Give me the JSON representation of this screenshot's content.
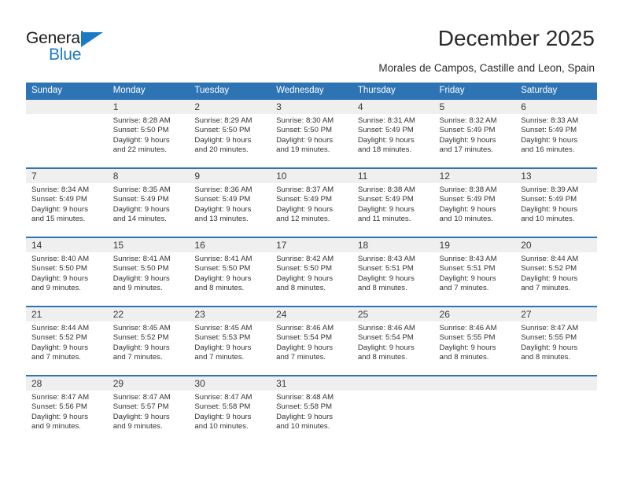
{
  "brand": {
    "name_top": "General",
    "name_bottom": "Blue",
    "accent_color": "#1b7ac4"
  },
  "header": {
    "title": "December 2025",
    "subtitle": "Morales de Campos, Castille and Leon, Spain"
  },
  "theme": {
    "header_bg": "#2e74b5",
    "daynum_bg": "#efefef",
    "text": "#333333"
  },
  "calendar": {
    "weekday_headers": [
      "Sunday",
      "Monday",
      "Tuesday",
      "Wednesday",
      "Thursday",
      "Friday",
      "Saturday"
    ],
    "weeks": [
      [
        {
          "day": "",
          "sunrise": "",
          "sunset": "",
          "daylight_line1": "",
          "daylight_line2": ""
        },
        {
          "day": "1",
          "sunrise": "Sunrise: 8:28 AM",
          "sunset": "Sunset: 5:50 PM",
          "daylight_line1": "Daylight: 9 hours",
          "daylight_line2": "and 22 minutes."
        },
        {
          "day": "2",
          "sunrise": "Sunrise: 8:29 AM",
          "sunset": "Sunset: 5:50 PM",
          "daylight_line1": "Daylight: 9 hours",
          "daylight_line2": "and 20 minutes."
        },
        {
          "day": "3",
          "sunrise": "Sunrise: 8:30 AM",
          "sunset": "Sunset: 5:50 PM",
          "daylight_line1": "Daylight: 9 hours",
          "daylight_line2": "and 19 minutes."
        },
        {
          "day": "4",
          "sunrise": "Sunrise: 8:31 AM",
          "sunset": "Sunset: 5:49 PM",
          "daylight_line1": "Daylight: 9 hours",
          "daylight_line2": "and 18 minutes."
        },
        {
          "day": "5",
          "sunrise": "Sunrise: 8:32 AM",
          "sunset": "Sunset: 5:49 PM",
          "daylight_line1": "Daylight: 9 hours",
          "daylight_line2": "and 17 minutes."
        },
        {
          "day": "6",
          "sunrise": "Sunrise: 8:33 AM",
          "sunset": "Sunset: 5:49 PM",
          "daylight_line1": "Daylight: 9 hours",
          "daylight_line2": "and 16 minutes."
        }
      ],
      [
        {
          "day": "7",
          "sunrise": "Sunrise: 8:34 AM",
          "sunset": "Sunset: 5:49 PM",
          "daylight_line1": "Daylight: 9 hours",
          "daylight_line2": "and 15 minutes."
        },
        {
          "day": "8",
          "sunrise": "Sunrise: 8:35 AM",
          "sunset": "Sunset: 5:49 PM",
          "daylight_line1": "Daylight: 9 hours",
          "daylight_line2": "and 14 minutes."
        },
        {
          "day": "9",
          "sunrise": "Sunrise: 8:36 AM",
          "sunset": "Sunset: 5:49 PM",
          "daylight_line1": "Daylight: 9 hours",
          "daylight_line2": "and 13 minutes."
        },
        {
          "day": "10",
          "sunrise": "Sunrise: 8:37 AM",
          "sunset": "Sunset: 5:49 PM",
          "daylight_line1": "Daylight: 9 hours",
          "daylight_line2": "and 12 minutes."
        },
        {
          "day": "11",
          "sunrise": "Sunrise: 8:38 AM",
          "sunset": "Sunset: 5:49 PM",
          "daylight_line1": "Daylight: 9 hours",
          "daylight_line2": "and 11 minutes."
        },
        {
          "day": "12",
          "sunrise": "Sunrise: 8:38 AM",
          "sunset": "Sunset: 5:49 PM",
          "daylight_line1": "Daylight: 9 hours",
          "daylight_line2": "and 10 minutes."
        },
        {
          "day": "13",
          "sunrise": "Sunrise: 8:39 AM",
          "sunset": "Sunset: 5:49 PM",
          "daylight_line1": "Daylight: 9 hours",
          "daylight_line2": "and 10 minutes."
        }
      ],
      [
        {
          "day": "14",
          "sunrise": "Sunrise: 8:40 AM",
          "sunset": "Sunset: 5:50 PM",
          "daylight_line1": "Daylight: 9 hours",
          "daylight_line2": "and 9 minutes."
        },
        {
          "day": "15",
          "sunrise": "Sunrise: 8:41 AM",
          "sunset": "Sunset: 5:50 PM",
          "daylight_line1": "Daylight: 9 hours",
          "daylight_line2": "and 9 minutes."
        },
        {
          "day": "16",
          "sunrise": "Sunrise: 8:41 AM",
          "sunset": "Sunset: 5:50 PM",
          "daylight_line1": "Daylight: 9 hours",
          "daylight_line2": "and 8 minutes."
        },
        {
          "day": "17",
          "sunrise": "Sunrise: 8:42 AM",
          "sunset": "Sunset: 5:50 PM",
          "daylight_line1": "Daylight: 9 hours",
          "daylight_line2": "and 8 minutes."
        },
        {
          "day": "18",
          "sunrise": "Sunrise: 8:43 AM",
          "sunset": "Sunset: 5:51 PM",
          "daylight_line1": "Daylight: 9 hours",
          "daylight_line2": "and 8 minutes."
        },
        {
          "day": "19",
          "sunrise": "Sunrise: 8:43 AM",
          "sunset": "Sunset: 5:51 PM",
          "daylight_line1": "Daylight: 9 hours",
          "daylight_line2": "and 7 minutes."
        },
        {
          "day": "20",
          "sunrise": "Sunrise: 8:44 AM",
          "sunset": "Sunset: 5:52 PM",
          "daylight_line1": "Daylight: 9 hours",
          "daylight_line2": "and 7 minutes."
        }
      ],
      [
        {
          "day": "21",
          "sunrise": "Sunrise: 8:44 AM",
          "sunset": "Sunset: 5:52 PM",
          "daylight_line1": "Daylight: 9 hours",
          "daylight_line2": "and 7 minutes."
        },
        {
          "day": "22",
          "sunrise": "Sunrise: 8:45 AM",
          "sunset": "Sunset: 5:52 PM",
          "daylight_line1": "Daylight: 9 hours",
          "daylight_line2": "and 7 minutes."
        },
        {
          "day": "23",
          "sunrise": "Sunrise: 8:45 AM",
          "sunset": "Sunset: 5:53 PM",
          "daylight_line1": "Daylight: 9 hours",
          "daylight_line2": "and 7 minutes."
        },
        {
          "day": "24",
          "sunrise": "Sunrise: 8:46 AM",
          "sunset": "Sunset: 5:54 PM",
          "daylight_line1": "Daylight: 9 hours",
          "daylight_line2": "and 7 minutes."
        },
        {
          "day": "25",
          "sunrise": "Sunrise: 8:46 AM",
          "sunset": "Sunset: 5:54 PM",
          "daylight_line1": "Daylight: 9 hours",
          "daylight_line2": "and 8 minutes."
        },
        {
          "day": "26",
          "sunrise": "Sunrise: 8:46 AM",
          "sunset": "Sunset: 5:55 PM",
          "daylight_line1": "Daylight: 9 hours",
          "daylight_line2": "and 8 minutes."
        },
        {
          "day": "27",
          "sunrise": "Sunrise: 8:47 AM",
          "sunset": "Sunset: 5:55 PM",
          "daylight_line1": "Daylight: 9 hours",
          "daylight_line2": "and 8 minutes."
        }
      ],
      [
        {
          "day": "28",
          "sunrise": "Sunrise: 8:47 AM",
          "sunset": "Sunset: 5:56 PM",
          "daylight_line1": "Daylight: 9 hours",
          "daylight_line2": "and 9 minutes."
        },
        {
          "day": "29",
          "sunrise": "Sunrise: 8:47 AM",
          "sunset": "Sunset: 5:57 PM",
          "daylight_line1": "Daylight: 9 hours",
          "daylight_line2": "and 9 minutes."
        },
        {
          "day": "30",
          "sunrise": "Sunrise: 8:47 AM",
          "sunset": "Sunset: 5:58 PM",
          "daylight_line1": "Daylight: 9 hours",
          "daylight_line2": "and 10 minutes."
        },
        {
          "day": "31",
          "sunrise": "Sunrise: 8:48 AM",
          "sunset": "Sunset: 5:58 PM",
          "daylight_line1": "Daylight: 9 hours",
          "daylight_line2": "and 10 minutes."
        },
        {
          "day": "",
          "sunrise": "",
          "sunset": "",
          "daylight_line1": "",
          "daylight_line2": ""
        },
        {
          "day": "",
          "sunrise": "",
          "sunset": "",
          "daylight_line1": "",
          "daylight_line2": ""
        },
        {
          "day": "",
          "sunrise": "",
          "sunset": "",
          "daylight_line1": "",
          "daylight_line2": ""
        }
      ]
    ]
  }
}
